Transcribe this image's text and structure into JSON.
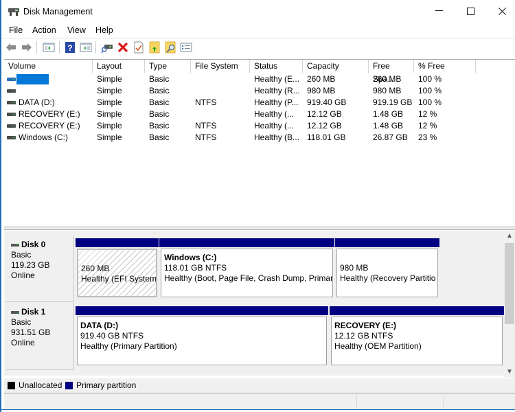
{
  "window": {
    "title": "Disk Management",
    "controls": {
      "minimize": "—",
      "maximize": "☐",
      "close": "✕"
    }
  },
  "menu": [
    "File",
    "Action",
    "View",
    "Help"
  ],
  "toolbar": {
    "icons": [
      "back-arrow-icon",
      "forward-arrow-icon",
      "show-hide-console-tree-icon",
      "help-icon",
      "show-hide-action-pane-icon",
      "connect-disk-icon",
      "delete-icon",
      "properties-icon",
      "open-folder-icon",
      "explore-icon",
      "list-view-icon"
    ]
  },
  "volume_list": {
    "columns": [
      "Volume",
      "Layout",
      "Type",
      "File System",
      "Status",
      "Capacity",
      "Free Spa...",
      "% Free"
    ],
    "rows": [
      {
        "volume": "",
        "layout": "Simple",
        "type": "Basic",
        "fs": "",
        "status": "Healthy (E...",
        "capacity": "260 MB",
        "free": "260 MB",
        "pct": "100 %",
        "selected": true
      },
      {
        "volume": "",
        "layout": "Simple",
        "type": "Basic",
        "fs": "",
        "status": "Healthy (R...",
        "capacity": "980 MB",
        "free": "980 MB",
        "pct": "100 %"
      },
      {
        "volume": "DATA (D:)",
        "layout": "Simple",
        "type": "Basic",
        "fs": "NTFS",
        "status": "Healthy (P...",
        "capacity": "919.40 GB",
        "free": "919.19 GB",
        "pct": "100 %"
      },
      {
        "volume": "RECOVERY (E:)",
        "layout": "Simple",
        "type": "Basic",
        "fs": "",
        "status": "Healthy (...",
        "capacity": "12.12 GB",
        "free": "1.48 GB",
        "pct": "12 %"
      },
      {
        "volume": "RECOVERY (E:)",
        "layout": "Simple",
        "type": "Basic",
        "fs": "NTFS",
        "status": "Healthy (...",
        "capacity": "12.12 GB",
        "free": "1.48 GB",
        "pct": "12 %"
      },
      {
        "volume": "Windows (C:)",
        "layout": "Simple",
        "type": "Basic",
        "fs": "NTFS",
        "status": "Healthy (B...",
        "capacity": "118.01 GB",
        "free": "26.87 GB",
        "pct": "23 %"
      }
    ]
  },
  "disks": [
    {
      "name": "Disk 0",
      "type": "Basic",
      "size": "119.23 GB",
      "state": "Online",
      "partitions": [
        {
          "title": "",
          "size": "260 MB",
          "status": "Healthy (EFI System",
          "hatched": true
        },
        {
          "title": "Windows  (C:)",
          "size": "118.01 GB NTFS",
          "status": "Healthy (Boot, Page File, Crash Dump, Primar"
        },
        {
          "title": "",
          "size": "980 MB",
          "status": "Healthy (Recovery Partitio"
        }
      ]
    },
    {
      "name": "Disk 1",
      "type": "Basic",
      "size": "931.51 GB",
      "state": "Online",
      "partitions": [
        {
          "title": "DATA  (D:)",
          "size": "919.40 GB NTFS",
          "status": "Healthy (Primary Partition)"
        },
        {
          "title": "RECOVERY  (E:)",
          "size": "12.12 GB NTFS",
          "status": "Healthy (OEM Partition)"
        }
      ]
    }
  ],
  "legend": [
    {
      "label": "Unallocated",
      "color": "#000000"
    },
    {
      "label": "Primary partition",
      "color": "#000080"
    }
  ],
  "colors": {
    "partition_bar": "#000080",
    "selection": "#0078d7",
    "window_border": "#1c6fb7"
  }
}
